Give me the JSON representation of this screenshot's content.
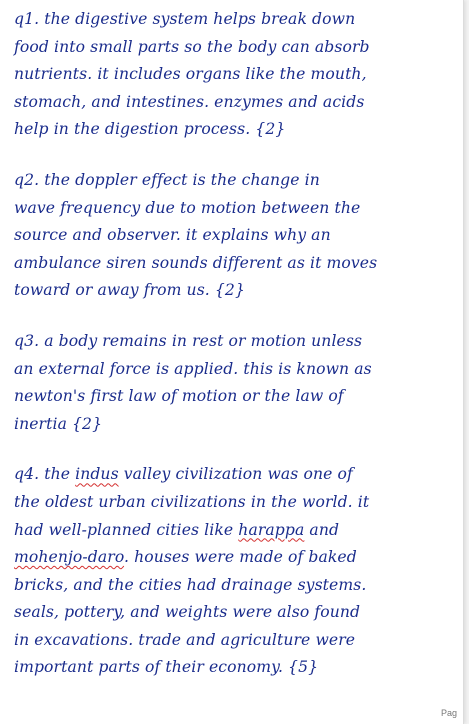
{
  "paragraphs": [
    {
      "lines": [
        [
          {
            "t": "q1. the digestive system helps break down"
          }
        ],
        [
          {
            "t": "food into small parts so the body can absorb"
          }
        ],
        [
          {
            "t": "nutrients. it includes organs like the mouth,"
          }
        ],
        [
          {
            "t": "stomach, and intestines. enzymes and acids"
          }
        ],
        [
          {
            "t": "help in the digestion process. {2}"
          }
        ]
      ]
    },
    {
      "lines": [
        [
          {
            "t": "q2. the doppler effect is the change in"
          }
        ],
        [
          {
            "t": "wave frequency due to motion between the"
          }
        ],
        [
          {
            "t": "source and observer. it explains why an"
          }
        ],
        [
          {
            "t": "ambulance siren sounds different as it moves"
          }
        ],
        [
          {
            "t": "toward or away from us. {2}"
          }
        ]
      ]
    },
    {
      "lines": [
        [
          {
            "t": "q3. a body remains in rest or motion unless"
          }
        ],
        [
          {
            "t": "an external force is applied. this is known as"
          }
        ],
        [
          {
            "t": "newton's first law of motion or the law of"
          }
        ],
        [
          {
            "t": "inertia {2}"
          }
        ]
      ]
    },
    {
      "lines": [
        [
          {
            "t": "q4. the "
          },
          {
            "t": "indus",
            "sq": true
          },
          {
            "t": " valley civilization was one of"
          }
        ],
        [
          {
            "t": "the oldest urban civilizations in the world. it"
          }
        ],
        [
          {
            "t": "had well-planned cities like "
          },
          {
            "t": "harappa",
            "sq": true
          },
          {
            "t": " and"
          }
        ],
        [
          {
            "t": "mohenjo-daro",
            "sq": true
          },
          {
            "t": ". houses were made of baked"
          }
        ],
        [
          {
            "t": "bricks, and the cities had drainage systems."
          }
        ],
        [
          {
            "t": "seals, pottery, and weights were also found"
          }
        ],
        [
          {
            "t": "in excavations. trade and agriculture were"
          }
        ],
        [
          {
            "t": "important parts of their economy. {5}"
          }
        ]
      ]
    }
  ],
  "page_label": "Pag"
}
